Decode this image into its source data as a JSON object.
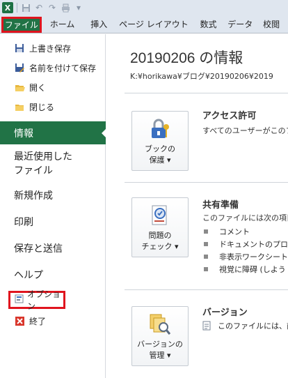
{
  "qat": {
    "app_icon": "excel-icon",
    "icons": [
      "save-icon",
      "undo-icon",
      "redo-icon",
      "print-icon",
      "customize-icon"
    ]
  },
  "tabs": [
    "ファイル",
    "ホーム",
    "挿入",
    "ページ レイアウト",
    "数式",
    "データ",
    "校閲"
  ],
  "nav": {
    "save": "上書き保存",
    "save_as": "名前を付けて保存",
    "open": "開く",
    "close": "閉じる",
    "info": "情報",
    "recent_1": "最近使用した",
    "recent_2": "ファイル",
    "new": "新規作成",
    "print": "印刷",
    "save_send": "保存と送信",
    "help": "ヘルプ",
    "options": "オプション",
    "exit": "終了"
  },
  "main": {
    "title": "20190206 の情報",
    "path": "K:¥horikawa¥ブログ¥20190206¥2019",
    "permissions": {
      "button_1": "ブックの",
      "button_2": "保護 ▾",
      "heading": "アクセス許可",
      "text": "すべてのユーザーがこのフ"
    },
    "prepare": {
      "button_1": "問題の",
      "button_2": "チェック ▾",
      "heading": "共有準備",
      "text": "このファイルには次の項目",
      "bullets": [
        "コメント",
        "ドキュメントのプロパ",
        "非表示ワークシート",
        "視覚に障碍 (しよう"
      ]
    },
    "versions": {
      "button_1": "バージョンの",
      "button_2": "管理 ▾",
      "heading": "バージョン",
      "text": "このファイルには、前"
    }
  },
  "colors": {
    "accent": "#217346",
    "highlight": "#e0141e"
  }
}
